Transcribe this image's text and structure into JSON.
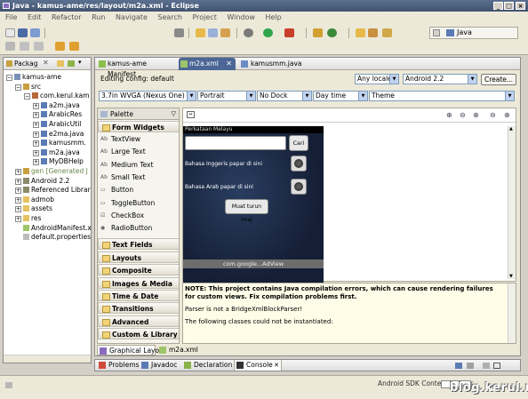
{
  "window": {
    "title": "Java - kamus-ame/res/layout/m2a.xml - Eclipse"
  },
  "menu": [
    "File",
    "Edit",
    "Refactor",
    "Run",
    "Navigate",
    "Search",
    "Project",
    "Window",
    "Help"
  ],
  "perspective": {
    "label": "Java"
  },
  "explorer": {
    "tab_label": "Packag",
    "items": [
      {
        "label": "kamus-ame",
        "indent": 0,
        "exp": "−",
        "icon": "project"
      },
      {
        "label": "src",
        "indent": 1,
        "exp": "−",
        "icon": "srcfolder"
      },
      {
        "label": "com.kerul.kam",
        "indent": 2,
        "exp": "−",
        "icon": "package"
      },
      {
        "label": "a2m.java",
        "indent": 3,
        "exp": "+",
        "icon": "java"
      },
      {
        "label": "ArabicRes",
        "indent": 3,
        "exp": "+",
        "icon": "java"
      },
      {
        "label": "ArabicUtil",
        "indent": 3,
        "exp": "+",
        "icon": "java"
      },
      {
        "label": "e2ma.java",
        "indent": 3,
        "exp": "+",
        "icon": "java"
      },
      {
        "label": "kamusmm.",
        "indent": 3,
        "exp": "+",
        "icon": "java"
      },
      {
        "label": "m2a.java",
        "indent": 3,
        "exp": "+",
        "icon": "java"
      },
      {
        "label": "MyDBHelp",
        "indent": 3,
        "exp": "+",
        "icon": "java"
      },
      {
        "label": "gen [Generated J",
        "indent": 1,
        "exp": "+",
        "icon": "srcfolder"
      },
      {
        "label": "Android 2.2",
        "indent": 1,
        "exp": "+",
        "icon": "lib"
      },
      {
        "label": "Referenced Librar",
        "indent": 1,
        "exp": "+",
        "icon": "lib"
      },
      {
        "label": "admob",
        "indent": 1,
        "exp": "+",
        "icon": "folder"
      },
      {
        "label": "assets",
        "indent": 1,
        "exp": "+",
        "icon": "folder"
      },
      {
        "label": "res",
        "indent": 1,
        "exp": "+",
        "icon": "folder"
      },
      {
        "label": "AndroidManifest.x",
        "indent": 1,
        "exp": "",
        "icon": "xml"
      },
      {
        "label": "default.properties",
        "indent": 1,
        "exp": "",
        "icon": "file"
      }
    ]
  },
  "editor_tabs": [
    {
      "label": "kamus-ame Manifest",
      "active": false
    },
    {
      "label": "m2a.xml",
      "active": true
    },
    {
      "label": "kamusmm.java",
      "active": false
    }
  ],
  "config": {
    "editing_label": "Editing config: default",
    "locale": "Any locale",
    "target": "Android 2.2",
    "create_label": "Create...",
    "device": "3.7in WVGA (Nexus One)",
    "orientation": "Portrait",
    "dock": "No Dock",
    "time": "Day time",
    "theme": "Theme"
  },
  "palette": {
    "title": "Palette",
    "form_header": "Form Widgets",
    "widgets": [
      {
        "label": "TextView",
        "icon": "Ab"
      },
      {
        "label": "Large Text",
        "icon": "Ab"
      },
      {
        "label": "Medium Text",
        "icon": "Ab"
      },
      {
        "label": "Small Text",
        "icon": "Ab"
      },
      {
        "label": "Button",
        "icon": "▭"
      },
      {
        "label": "ToggleButton",
        "icon": "▭"
      },
      {
        "label": "CheckBox",
        "icon": "☑"
      },
      {
        "label": "RadioButton",
        "icon": "◉"
      }
    ],
    "categories": [
      "Text Fields",
      "Layouts",
      "Composite",
      "Images & Media",
      "Time & Date",
      "Transitions",
      "Advanced",
      "Custom & Library Vie"
    ]
  },
  "device_screen": {
    "title_text": "Perkataan Melayu",
    "search_button": "Cari",
    "row1_text": "Bahasa Inggeris papar di sini",
    "row2_text": "Bahasa Arab papar di sini",
    "download_button": "Muat turun imej",
    "adview_text": "com.google...AdView"
  },
  "error_panel": {
    "note": "NOTE: This project contains Java compilation errors, which can cause rendering failures for custom views. Fix compilation problems first.",
    "line1": "Parser is not a BridgeXmlBlockParser!",
    "line2": "The following classes could not be instantiated:"
  },
  "editor_bottom_tabs": [
    "Graphical Layout",
    "m2a.xml"
  ],
  "bottom_tabs": [
    "Problems",
    "Javadoc",
    "Declaration",
    "Console"
  ],
  "status": {
    "text": "Android SDK Content Loader"
  },
  "watermark": "blog.kerul.net",
  "colors": {
    "title_bar": "#4a5b7a",
    "device_bg": "#1c2a45",
    "error_text": "#000000"
  }
}
